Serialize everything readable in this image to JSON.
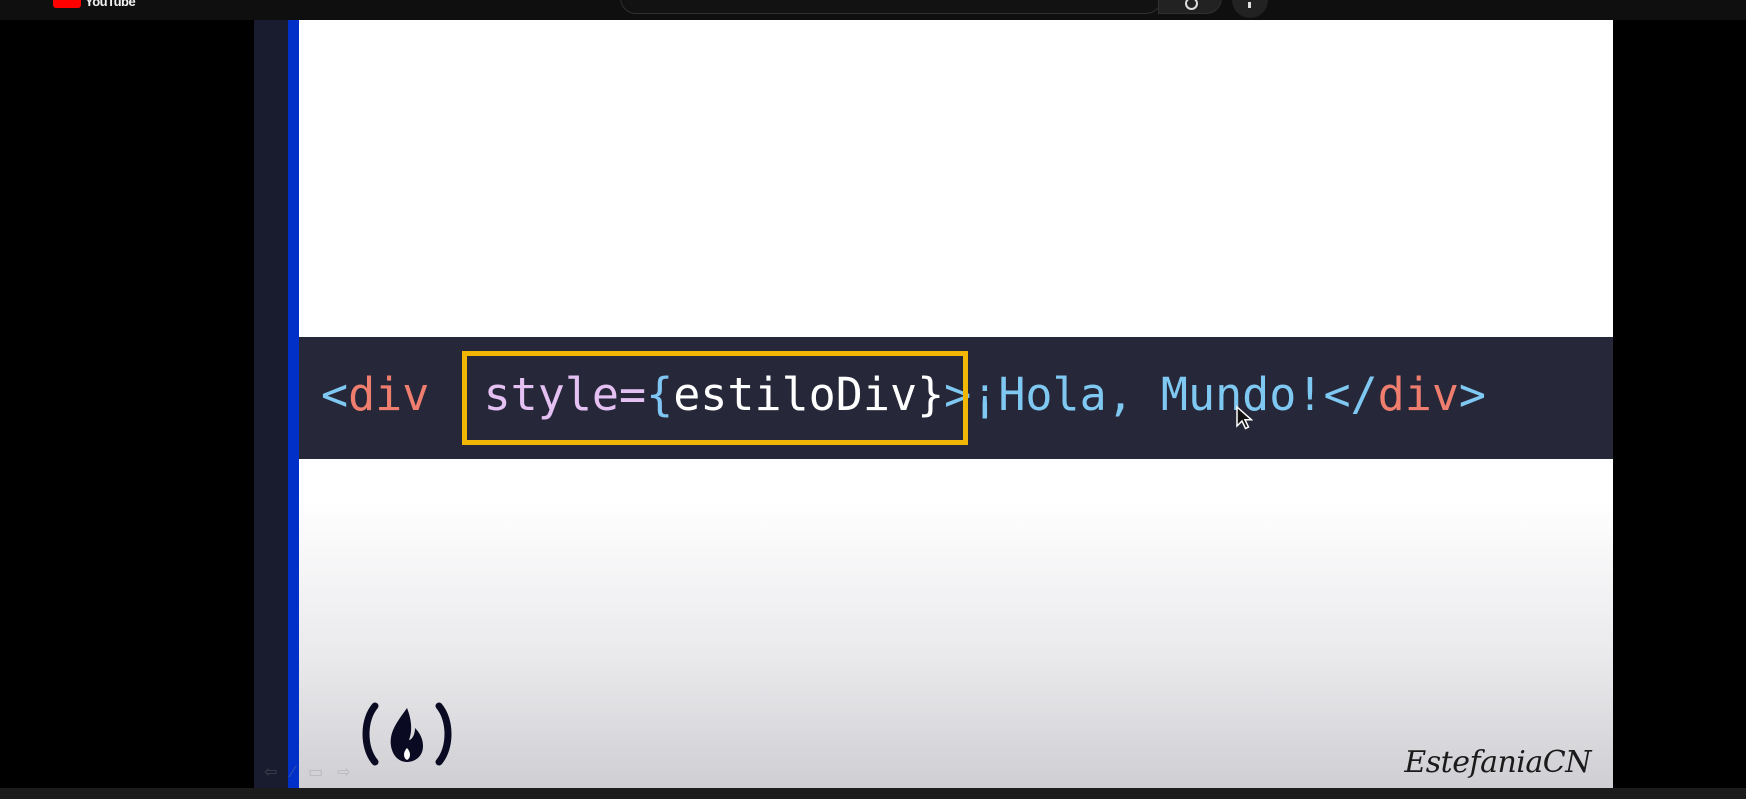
{
  "topbar": {
    "logo_text": "YouTube"
  },
  "code": {
    "open_bracket": "<",
    "tag_open": "div",
    "space": " ",
    "attr": "style",
    "equals": "=",
    "brace_open": "{",
    "var": "estiloDiv",
    "brace_close": "}",
    "close_bracket": ">",
    "content": "¡Hola, Mundo!",
    "end_open": "</",
    "tag_close": "div",
    "end_close": ">"
  },
  "watermark": {
    "author": "EstefaniaCN"
  },
  "colors": {
    "highlight": "#f2b705",
    "code_background": "#262839",
    "accent_bar": "#0030c8"
  },
  "icons": {
    "logo": "freecodecamp-logo-icon",
    "cursor": "mouse-pointer-icon"
  }
}
